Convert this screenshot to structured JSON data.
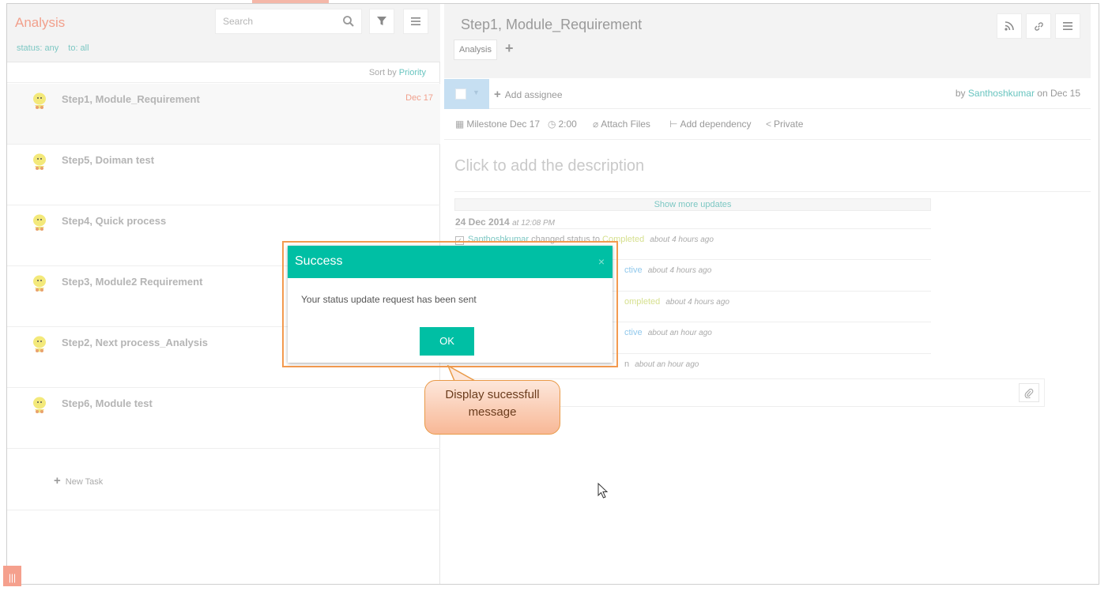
{
  "left_panel": {
    "project_title": "Analysis",
    "search_placeholder": "Search",
    "filters": {
      "status": "status: any",
      "to": "to: all"
    },
    "sort": {
      "label": "Sort by",
      "value": "Priority"
    },
    "tasks": [
      {
        "name": "Step1, Module_Requirement",
        "date": "Dec 17"
      },
      {
        "name": "Step5, Doiman test",
        "date": ""
      },
      {
        "name": "Step4, Quick process",
        "date": ""
      },
      {
        "name": "Step3, Module2 Requirement",
        "date": ""
      },
      {
        "name": "Step2, Next process_Analysis",
        "date": ""
      },
      {
        "name": "Step6, Module test",
        "date": ""
      }
    ],
    "new_task_label": "New Task",
    "corner_button_label": "|||"
  },
  "detail": {
    "title": "Step1, Module_Requirement",
    "tab_label": "Analysis",
    "add_tab_label": "+",
    "add_assignee_label": "Add assignee",
    "by_prefix": "by",
    "by_user": "Santhoshkumar",
    "on_date": "on Dec 15",
    "meta": {
      "milestone": "Milestone Dec 17",
      "time": "2:00",
      "attach_files": "Attach Files",
      "add_dependency": "Add dependency",
      "private": "Private"
    },
    "description_placeholder": "Click to add the description",
    "show_more_label": "Show more updates",
    "updates_date": "24 Dec 2014",
    "updates_time": "at 12:08 PM",
    "updates": [
      {
        "user": "Santhoshkumar",
        "action": "changed status to",
        "status": "Completed",
        "ago": "about 4 hours ago"
      },
      {
        "user": "",
        "action": "",
        "status": "ctive",
        "ago": "about 4 hours ago"
      },
      {
        "user": "",
        "action": "",
        "status": "ompleted",
        "ago": "about 4 hours ago"
      },
      {
        "user": "",
        "action": "",
        "status": "ctive",
        "ago": "about an hour ago"
      },
      {
        "user": "",
        "action": "",
        "status": "n",
        "ago": "about an hour ago"
      }
    ]
  },
  "modal": {
    "title": "Success",
    "close_label": "×",
    "message": "Your status update request has been sent",
    "ok_label": "OK"
  },
  "callout": {
    "line1": "Display sucessfull",
    "line2": "message"
  },
  "colors": {
    "accent_teal": "#00bfa4",
    "project_orange": "#f2a08c",
    "highlight_orange": "#f39a4f"
  }
}
